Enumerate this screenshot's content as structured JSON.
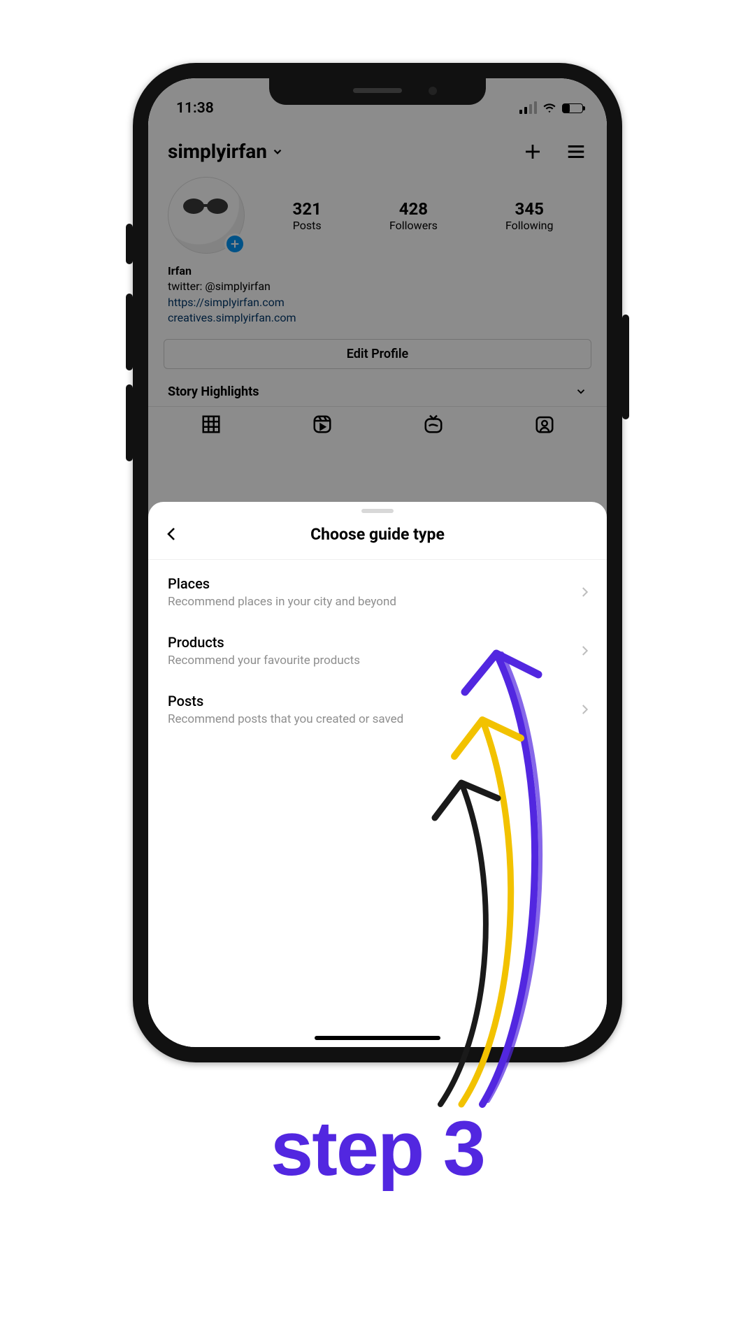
{
  "status": {
    "time": "11:38"
  },
  "profile": {
    "username": "simplyirfan",
    "stats": {
      "posts": {
        "count": "321",
        "label": "Posts"
      },
      "followers": {
        "count": "428",
        "label": "Followers"
      },
      "following": {
        "count": "345",
        "label": "Following"
      }
    },
    "bio": {
      "name": "Irfan",
      "line1": "twitter: @simplyirfan",
      "link1": "https://simplyirfan.com",
      "link2": "creatives.simplyirfan.com"
    },
    "edit_profile_label": "Edit Profile",
    "story_highlights_label": "Story Highlights"
  },
  "sheet": {
    "title": "Choose guide type",
    "rows": [
      {
        "title": "Places",
        "subtitle": "Recommend places in your city and beyond"
      },
      {
        "title": "Products",
        "subtitle": "Recommend your favourite products"
      },
      {
        "title": "Posts",
        "subtitle": "Recommend posts that you created or saved"
      }
    ]
  },
  "annotation": {
    "step_label": "step 3",
    "colors": {
      "accent": "#5227e0",
      "arrow_yellow": "#f2c200",
      "arrow_black": "#1a1a1a"
    }
  }
}
